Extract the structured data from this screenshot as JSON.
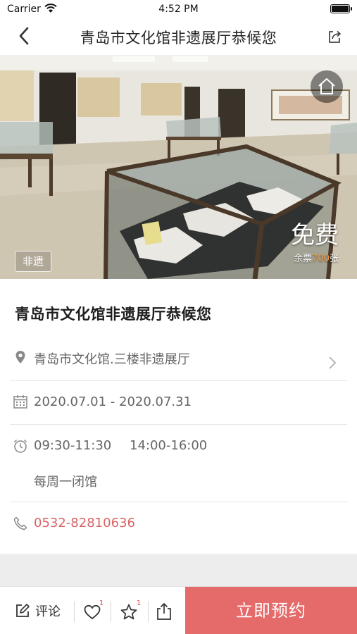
{
  "status_bar": {
    "carrier": "Carrier",
    "time": "4:52 PM"
  },
  "nav": {
    "title": "青岛市文化馆非遗展厅恭候您"
  },
  "hero": {
    "tag": "非遗",
    "price": "免费",
    "remaining_prefix": "余票",
    "remaining_count": "700",
    "remaining_suffix": "张"
  },
  "venue": {
    "title": "青岛市文化馆非遗展厅恭候您",
    "address": "青岛市文化馆.三楼非遗展厅",
    "date_range": "2020.07.01 - 2020.07.31",
    "hours_1": "09:30-11:30",
    "hours_2": "14:00-16:00",
    "closed_note": "每周一闭馆",
    "phone": "0532-82810636"
  },
  "bottom_bar": {
    "comment_label": "评论",
    "like_count": "1",
    "favorite_count": "1",
    "reserve_label": "立即预约"
  },
  "colors": {
    "accent": "#e56a6a",
    "phone": "#d96464",
    "remaining_count": "#f39a3a"
  }
}
